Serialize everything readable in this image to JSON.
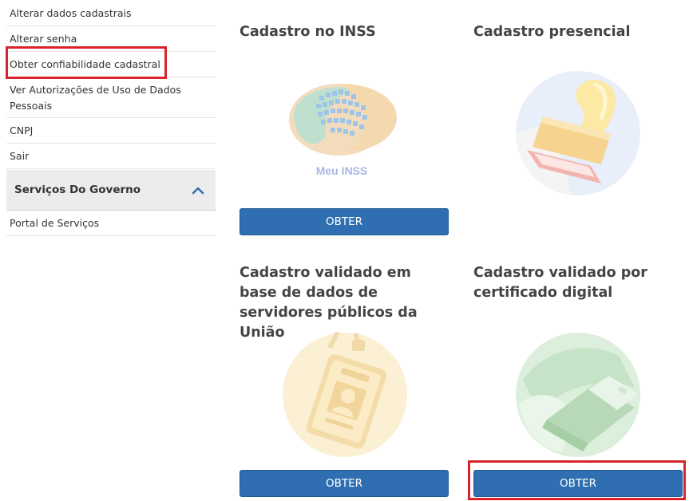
{
  "sidebar": {
    "items": [
      {
        "label": "Alterar dados cadastrais"
      },
      {
        "label": "Alterar senha"
      },
      {
        "label": "Obter confiabilidade cadastral"
      },
      {
        "label": "Ver Autorizações de Uso de Dados Pessoais"
      },
      {
        "label": "CNPJ"
      },
      {
        "label": "Sair"
      }
    ],
    "section": {
      "title": "Serviços Do Governo",
      "icon": "chevron-up-icon"
    },
    "section_items": [
      {
        "label": "Portal de Serviços"
      }
    ]
  },
  "cards": [
    {
      "title": "Cadastro no INSS",
      "logo_text": "Meu INSS",
      "button": "OBTER"
    },
    {
      "title": "Cadastro presencial"
    },
    {
      "title": "Cadastro validado em base de dados de servidores públicos da União",
      "button": "OBTER"
    },
    {
      "title": "Cadastro validado por certificado digital",
      "button": "OBTER"
    }
  ],
  "colors": {
    "button": "#2f6fb1",
    "highlight": "#d9232a",
    "section_bg": "#ececec"
  }
}
